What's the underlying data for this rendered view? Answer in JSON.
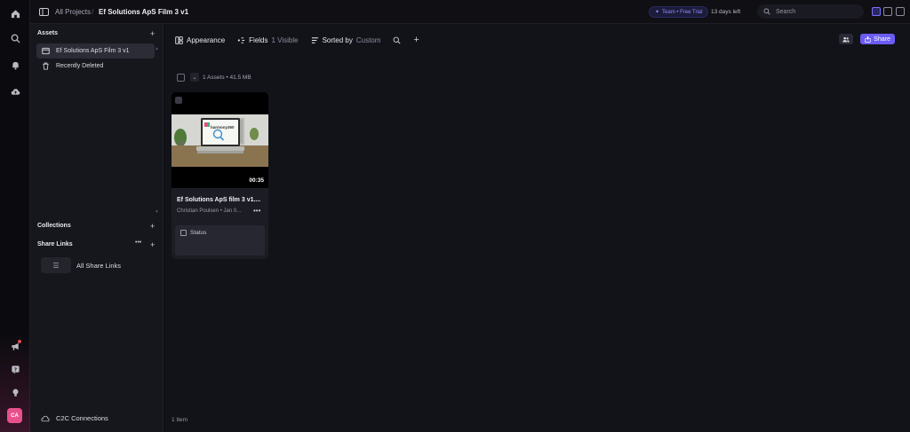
{
  "topbar": {
    "breadcrumb_root": "All Projects",
    "breadcrumb_sep": "/",
    "breadcrumb_current": "Ef Solutions ApS Film 3 v1",
    "trial_badge": "Team • Free Trial",
    "days_left": "13 days left",
    "search_placeholder": "Search"
  },
  "rail": {
    "icons": [
      "home-icon",
      "search-icon",
      "bell-icon",
      "cloud-upload-icon",
      "megaphone-icon",
      "help-icon",
      "lightbulb-icon"
    ],
    "avatar_initials": "CA"
  },
  "sidebar": {
    "assets_heading": "Assets",
    "items": [
      {
        "label": "Ef Solutions ApS Film 3 v1",
        "icon": "project-icon",
        "active": true
      },
      {
        "label": "Recently Deleted",
        "icon": "trash-icon",
        "active": false
      }
    ],
    "collections_heading": "Collections",
    "share_links_heading": "Share Links",
    "share_links_more": "•••",
    "all_share_links": "All Share Links",
    "c2c_label": "C2C Connections"
  },
  "toolbar": {
    "appearance": "Appearance",
    "fields_label": "Fields",
    "fields_value": "1 Visible",
    "sorted_label": "Sorted by",
    "sorted_value": "Custom",
    "share_label": "Share"
  },
  "assets": {
    "count_text": "1 Assets • 41.5 MB",
    "cards": [
      {
        "title": "Ef Solutions ApS film 3 v1....",
        "meta": "Christian Poulsen • Jan 0...",
        "duration": "00:35",
        "thumb_logo_text": "harmony360",
        "status_label": "Status"
      }
    ],
    "footer": "1 Item"
  },
  "colors": {
    "accent": "#6b5cf6",
    "trial": "#8f8cff",
    "avatar": "#e8508c"
  }
}
